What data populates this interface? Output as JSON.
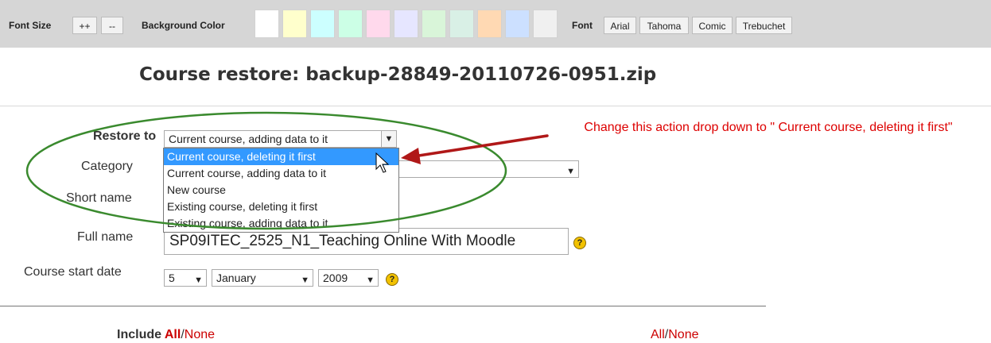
{
  "toolbar": {
    "font_size_label": "Font Size",
    "increase_label": "++",
    "decrease_label": "--",
    "background_color_label": "Background Color",
    "swatch_colors": [
      "#ffffff",
      "#ffffcc",
      "#ccffff",
      "#ccffe6",
      "#ffd9ec",
      "#e6e6ff",
      "#d9f5d9",
      "#d9f0e6",
      "#ffd9b3",
      "#cce0ff",
      "#f0f0f0"
    ],
    "font_label": "Font",
    "fonts": [
      "Arial",
      "Tahoma",
      "Comic",
      "Trebuchet"
    ]
  },
  "page": {
    "title": "Course restore: backup-28849-20110726-0951.zip"
  },
  "form": {
    "restore_to": {
      "label": "Restore to",
      "value": "Current course, adding data to it",
      "options": [
        "Current course, deleting it first",
        "Current course, adding data to it",
        "New course",
        "Existing course, deleting it first",
        "Existing course, adding data to it"
      ],
      "highlighted_index": 0
    },
    "category": {
      "label": "Category"
    },
    "short_name": {
      "label": "Short name"
    },
    "full_name": {
      "label": "Full name",
      "value": "SP09ITEC_2525_N1_Teaching Online With Moodle"
    },
    "course_start_date": {
      "label": "Course start date",
      "day": "5",
      "month": "January",
      "year": "2009"
    },
    "help_icon": "?"
  },
  "include": {
    "label": "Include",
    "all": "All",
    "separator": "/",
    "none": "None"
  },
  "annotation": {
    "text": "Change this action drop down to \" Current course, deleting it first\"",
    "color": "#dd0000",
    "ellipse_color": "#3a8a2e"
  }
}
